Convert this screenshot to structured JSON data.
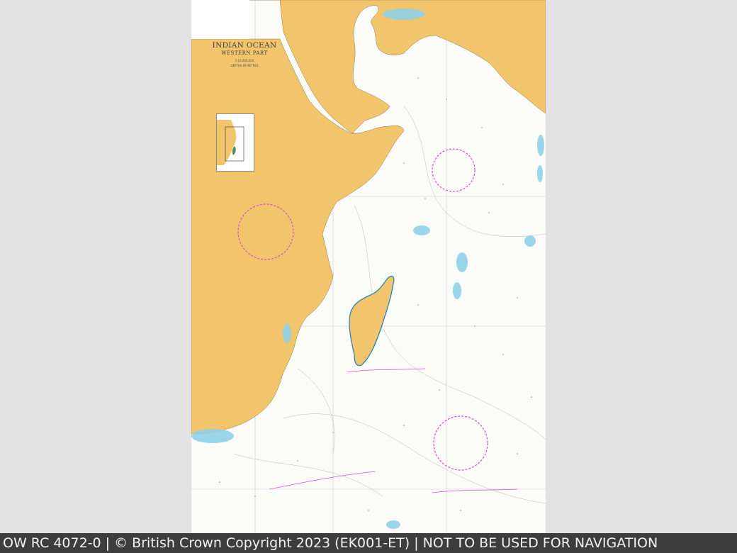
{
  "chart": {
    "title": "INDIAN OCEAN",
    "subtitle": "WESTERN PART",
    "scale_text": "1:10,000,000",
    "depths_text": "DEPTHS IN METRES"
  },
  "caption": {
    "text": "OW RC 4072-0 | © British Crown Copyright 2023 (EK001-ET) | NOT TO BE USED FOR NAVIGATION"
  },
  "colors": {
    "land": "#f2c46b",
    "sea": "#fbfbf8",
    "shallow_water": "#8fd2e8",
    "depth_contour": "#b8b8b8",
    "magenta_lines": "#d24fd2",
    "caption_bg": "#3d3d3d"
  }
}
